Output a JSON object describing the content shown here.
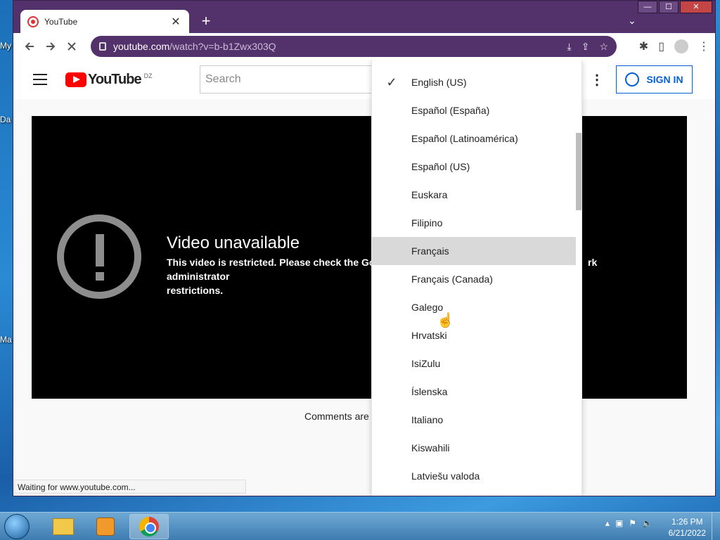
{
  "desktop": {
    "labels": [
      "My",
      "Da",
      "Ma"
    ]
  },
  "browser": {
    "tab_title": "YouTube",
    "tab_close": "✕",
    "new_tab": "+",
    "tab_search": "⌄",
    "url_domain": "youtube.com",
    "url_path": "/watch?v=b-b1Zwx303Q",
    "window_buttons": {
      "minimize": "—",
      "maximize": "☐",
      "close": "✕"
    },
    "status": "Waiting for www.youtube.com..."
  },
  "youtube": {
    "logo_text": "YouTube",
    "country_code": "DZ",
    "search_placeholder": "Search",
    "sign_in_label": "SIGN IN",
    "unavailable_title": "Video unavailable",
    "unavailable_message_left": "This video is restricted. Please check the Goo",
    "unavailable_message_right": "rk administrator",
    "unavailable_message_line2": "restrictions.",
    "comments_text": "Comments are"
  },
  "language_menu": {
    "selected": "English (US)",
    "hovered": "Français",
    "items": [
      "English (US)",
      "Español (España)",
      "Español (Latinoamérica)",
      "Español (US)",
      "Euskara",
      "Filipino",
      "Français",
      "Français (Canada)",
      "Galego",
      "Hrvatski",
      "IsiZulu",
      "Íslenska",
      "Italiano",
      "Kiswahili",
      "Latviešu valoda"
    ]
  },
  "taskbar": {
    "time": "1:26 PM",
    "date": "6/21/2022"
  }
}
